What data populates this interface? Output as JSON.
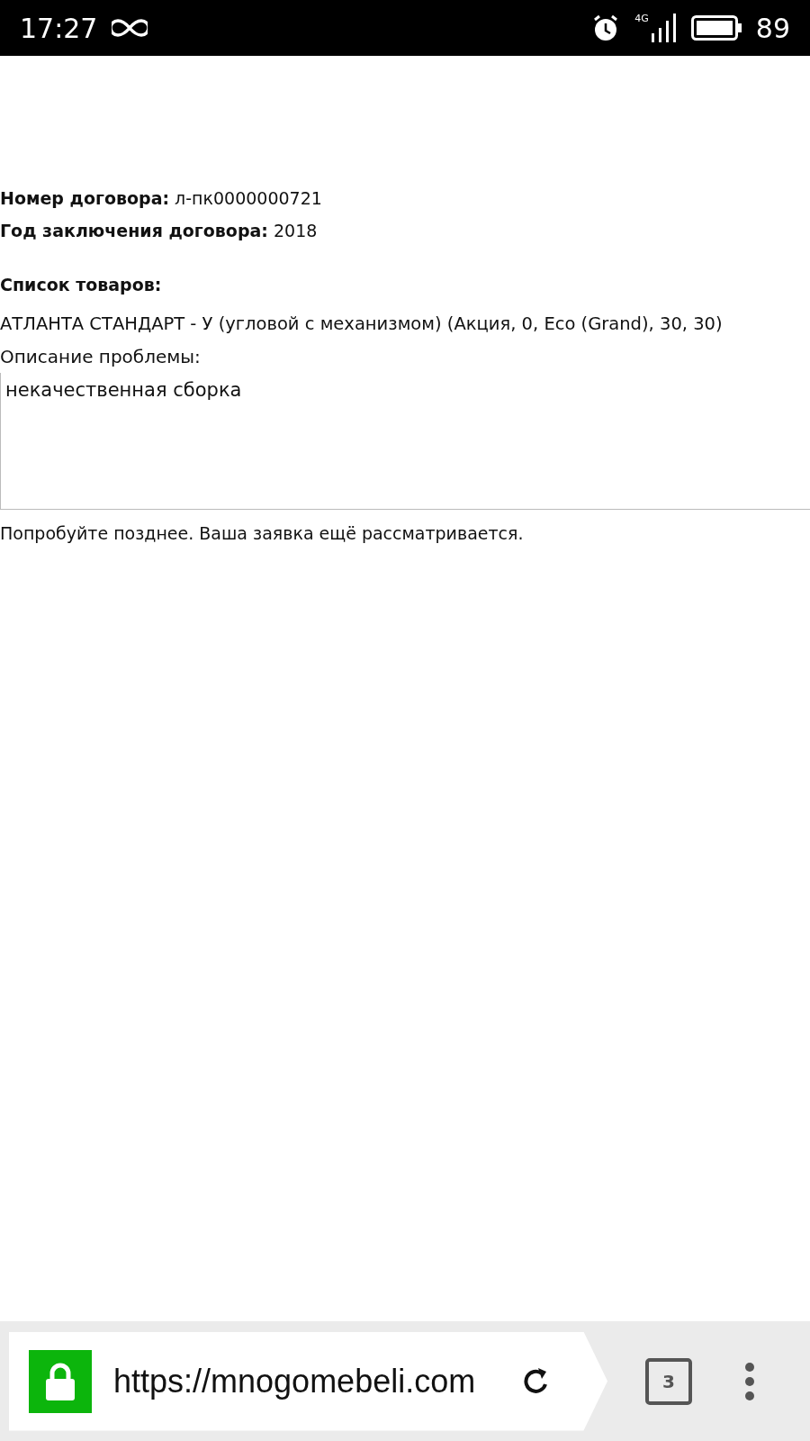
{
  "status_bar": {
    "time": "17:27",
    "network": "4G",
    "battery": "89"
  },
  "contract": {
    "number_label": "Номер договора:",
    "number": "л-пк0000000721",
    "year_label": "Год заключения договора:",
    "year": "2018"
  },
  "goods": {
    "heading": "Список товаров:",
    "items": [
      "АТЛАНТА СТАНДАРТ - У (угловой с механизмом) (Акция, 0, Eco (Grand), 30, 30)"
    ]
  },
  "problem": {
    "label": "Описание проблемы:",
    "value": "некачественная сборка"
  },
  "message": "Попробуйте позднее. Ваша заявка ещё рассматривается.",
  "browser_bar": {
    "secure": true,
    "url": "https://mnogomebeli.com",
    "tab_count": "3"
  }
}
